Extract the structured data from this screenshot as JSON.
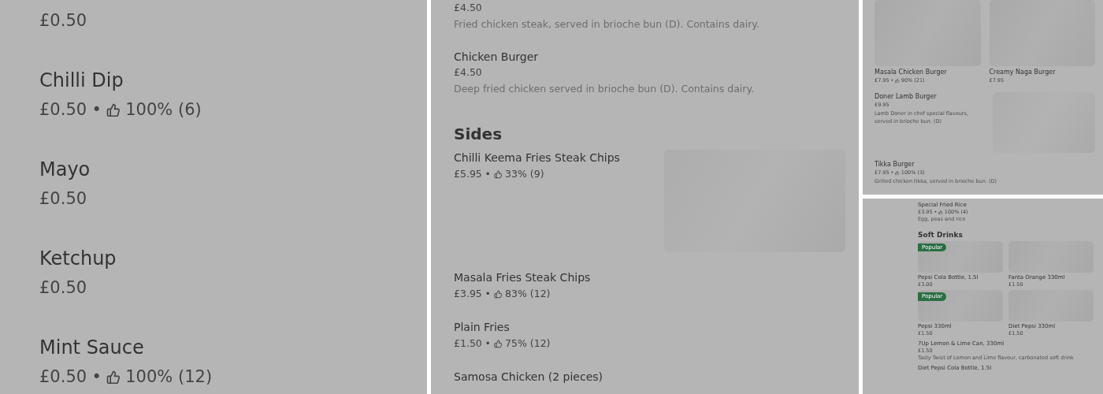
{
  "panels": [
    {
      "kind": "large",
      "blocks": [
        {
          "kind": "item",
          "price": "£0.50"
        },
        {
          "kind": "item",
          "name": "Chilli Dip",
          "price": "£0.50",
          "separator": "•",
          "rating": "100% (6)"
        },
        {
          "kind": "item",
          "name": "Mayo",
          "price": "£0.50"
        },
        {
          "kind": "item",
          "name": "Ketchup",
          "price": "£0.50"
        },
        {
          "kind": "item",
          "name": "Mint Sauce",
          "price": "£0.50",
          "separator": "•",
          "rating": "100% (12)"
        }
      ]
    },
    {
      "kind": "medium",
      "blocks": [
        {
          "kind": "item",
          "price": "£4.50",
          "description": "Fried chicken steak, served in brioche bun (D). Contains dairy."
        },
        {
          "kind": "item",
          "name": "Chicken Burger",
          "price": "£4.50",
          "description": "Deep fried chicken served in brioche bun (D). Contains dairy."
        },
        {
          "kind": "heading",
          "text": "Sides"
        },
        {
          "kind": "item",
          "name": "Chilli Keema Fries Steak Chips",
          "price": "£5.95",
          "separator": "•",
          "rating": "33% (9)",
          "picture": true
        },
        {
          "kind": "item",
          "name": "Masala Fries Steak Chips",
          "price": "£3.95",
          "separator": "•",
          "rating": "83% (12)"
        },
        {
          "kind": "item",
          "name": "Plain Fries",
          "price": "£1.50",
          "separator": "•",
          "rating": "75% (12)"
        },
        {
          "kind": "item",
          "name": "Samosa Chicken (2 pieces)"
        }
      ]
    },
    {
      "kind": "small",
      "blocks": [
        {
          "kind": "cards",
          "cards": [
            {
              "name": "Masala Chicken Burger",
              "price": "£7.95",
              "separator": "•",
              "rating": "90% (21)"
            },
            {
              "name": "Creamy Naga Burger",
              "price": "£7.95"
            }
          ]
        },
        {
          "kind": "item",
          "name": "Doner Lamb Burger",
          "price": "£9.95",
          "description": "Lamb Doner in chef special flavours, served in brioche bun. (D)",
          "picture": true
        },
        {
          "kind": "item",
          "name": "Tikka Burger",
          "price": "£7.95",
          "separator": "•",
          "rating": "100% (3)",
          "description": "Grilled chicken tikka, served in brioche bun. (D)"
        }
      ]
    },
    {
      "kind": "tiny",
      "blocks": [
        {
          "kind": "item",
          "name": "Special Fried Rice",
          "price": "£3.95",
          "separator": "•",
          "rating": "100% (4)",
          "description": "Egg, peas and rice"
        },
        {
          "kind": "heading",
          "text": "Soft Drinks"
        },
        {
          "kind": "cards",
          "cards": [
            {
              "name": "Pepsi Cola Bottle, 1.5l",
              "price": "£3.00",
              "badge": "Popular"
            },
            {
              "name": "Fanta Orange 330ml",
              "price": "£1.50"
            },
            {
              "name": "Pepsi 330ml",
              "price": "£1.50",
              "badge": "Popular"
            },
            {
              "name": "Diet Pepsi 330ml",
              "price": "£1.50"
            }
          ]
        },
        {
          "kind": "item",
          "name": "7Up Lemon & Lime Can, 330ml",
          "price": "£1.50",
          "description": "Tasty Twist of Lemon and Lime flavour, carbonated soft drink"
        },
        {
          "kind": "item",
          "name": "Diet Pepsi Cola Bottle, 1.5l"
        }
      ]
    }
  ]
}
